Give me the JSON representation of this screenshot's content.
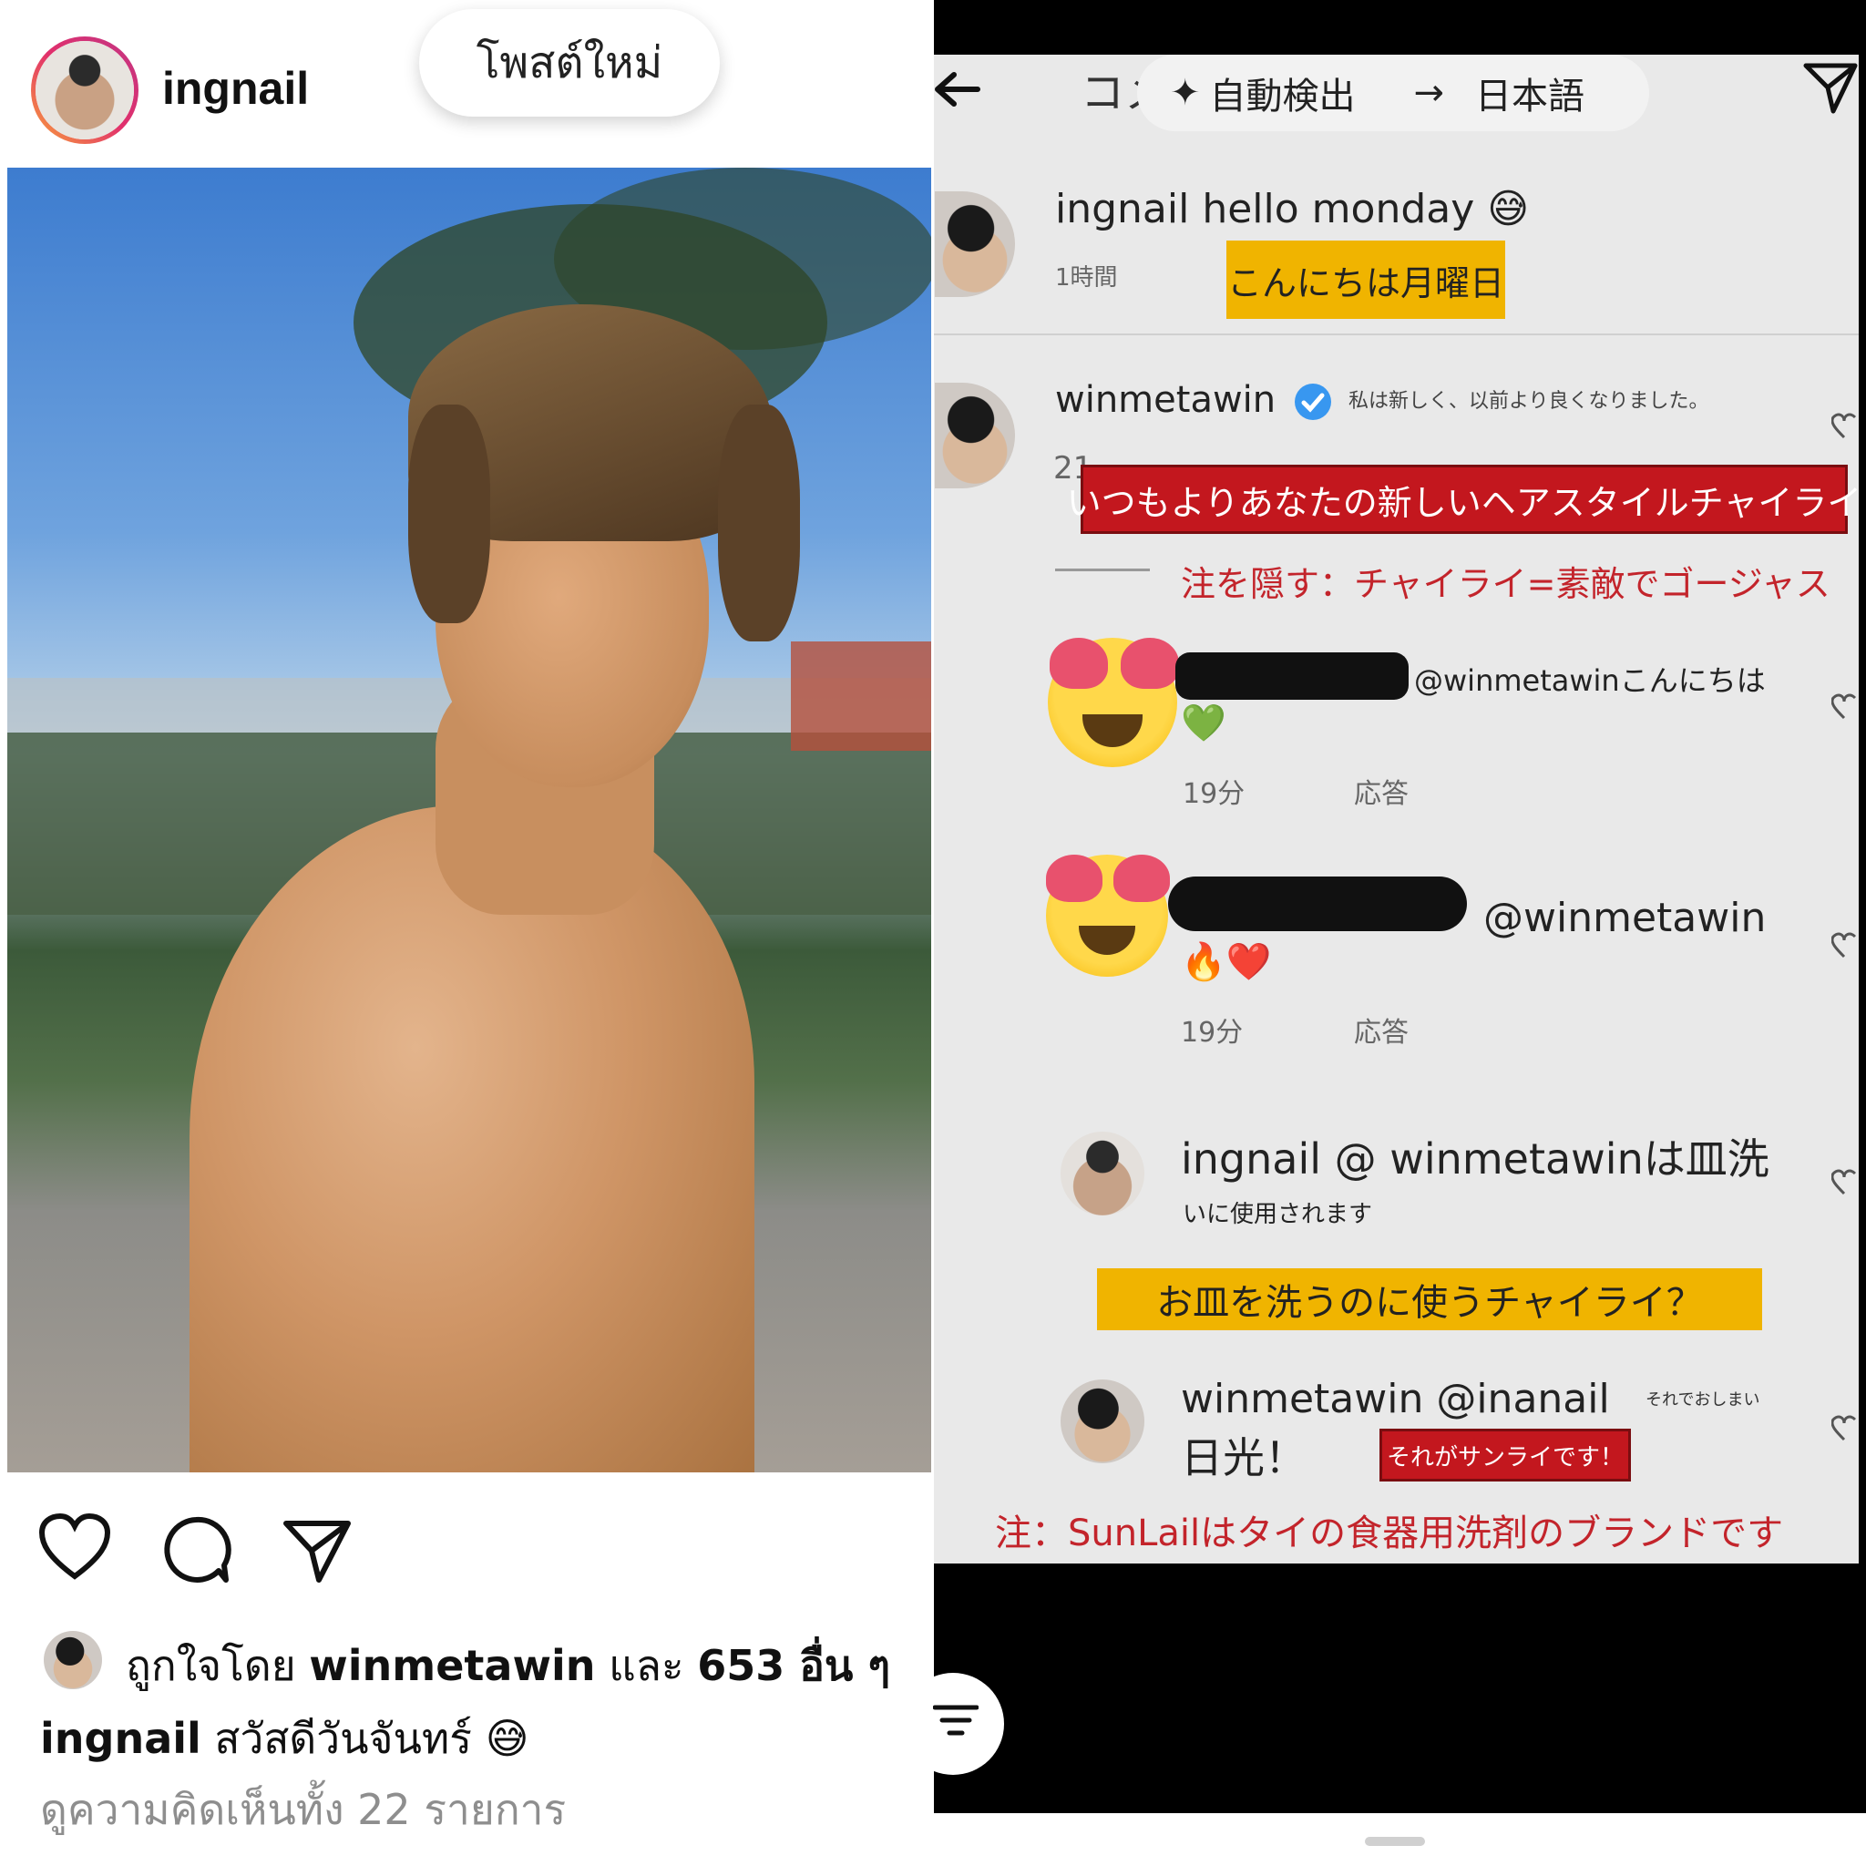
{
  "left": {
    "post_header": {
      "username": "ingnail",
      "new_posts_pill": "โพสต์ใหม่"
    },
    "actions": {
      "like_icon": "heart-outline",
      "comment_icon": "speech-bubble",
      "share_icon": "paper-plane"
    },
    "liked_by": {
      "prefix": "ถูกใจโดย",
      "user": "winmetawin",
      "middle": "และ",
      "count_text": "653 อื่น ๆ"
    },
    "caption": {
      "username": "ingnail",
      "text": "สวัสดีวันจันทร์ 😅"
    },
    "view_comments": "ดูความคิดเห็นทั้ง 22 รายการ"
  },
  "right": {
    "header": {
      "back_icon": "arrow-left",
      "title_partial": "コメ",
      "translate_source": "自動検出",
      "translate_arrow": "→",
      "translate_target": "日本語",
      "share_icon": "paper-plane"
    },
    "caption_comment": {
      "username": "ingnail",
      "text": "hello monday 😅",
      "time": "1時間",
      "translation": "こんにちは月曜日"
    },
    "comment1": {
      "username": "winmetawin",
      "translated": "私は新しく、以前より良くなりました。",
      "time_partial": "21",
      "translation": "いつもよりあなたの新しいヘアスタイルチャイライ",
      "note": "注を隠す：チャイライ=素敵でゴージャス"
    },
    "reply1": {
      "mention": "@winmetawinこんにちは",
      "emoji": "💚",
      "time": "19分",
      "reply_label": "応答"
    },
    "reply2": {
      "mention": "@winmetawin",
      "emoji": "🔥❤️",
      "time": "19分",
      "reply_label": "応答"
    },
    "reply3": {
      "line1": "ingnail @ winmetawinは皿洗",
      "line2": "いに使用されます",
      "translation": "お皿を洗うのに使うチャイライ？"
    },
    "reply4": {
      "line1": "winmetawin @inanail",
      "side_note": "それでおしまい",
      "line2": "日光！",
      "translation": "それがサンライです！"
    },
    "footer_note": "注：SunLailはタイの食器用洗剤のブランドです",
    "filter_icon": "filter-lines"
  },
  "colors": {
    "highlight_yellow": "#f0b400",
    "highlight_red": "#c3171e",
    "note_red": "#c3242b",
    "verified_blue": "#3897f0"
  }
}
